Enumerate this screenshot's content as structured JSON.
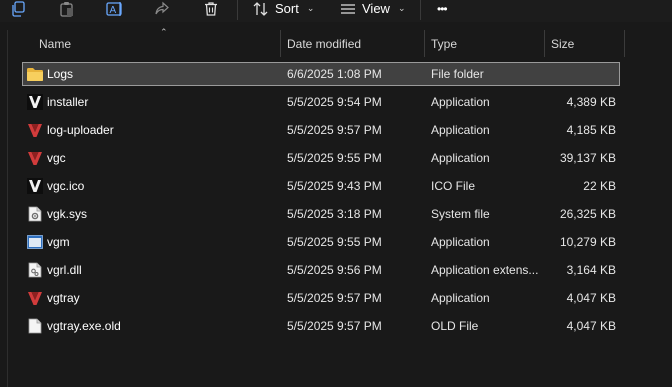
{
  "toolbar": {
    "copy_icon": "copy-icon",
    "paste_icon": "paste-icon",
    "rename_icon": "rename-icon",
    "share_icon": "share-icon",
    "delete_icon": "trash-icon",
    "sort_label": "Sort",
    "view_label": "View",
    "more_label": "•••"
  },
  "columns": {
    "name": "Name",
    "date": "Date modified",
    "type": "Type",
    "size": "Size"
  },
  "files": [
    {
      "name": "Logs",
      "date": "6/6/2025 1:08 PM",
      "type": "File folder",
      "size": "",
      "icon": "folder-icon",
      "selected": true
    },
    {
      "name": "installer",
      "date": "5/5/2025 9:54 PM",
      "type": "Application",
      "size": "4,389 KB",
      "icon": "vanguard-black-app-icon"
    },
    {
      "name": "log-uploader",
      "date": "5/5/2025 9:57 PM",
      "type": "Application",
      "size": "4,185 KB",
      "icon": "vanguard-red-app-icon"
    },
    {
      "name": "vgc",
      "date": "5/5/2025 9:55 PM",
      "type": "Application",
      "size": "39,137 KB",
      "icon": "vanguard-red-app-icon"
    },
    {
      "name": "vgc.ico",
      "date": "5/5/2025 9:43 PM",
      "type": "ICO File",
      "size": "22 KB",
      "icon": "vanguard-black-app-icon"
    },
    {
      "name": "vgk.sys",
      "date": "5/5/2025 3:18 PM",
      "type": "System file",
      "size": "26,325 KB",
      "icon": "system-file-icon"
    },
    {
      "name": "vgm",
      "date": "5/5/2025 9:55 PM",
      "type": "Application",
      "size": "10,279 KB",
      "icon": "window-app-icon"
    },
    {
      "name": "vgrl.dll",
      "date": "5/5/2025 9:56 PM",
      "type": "Application extens...",
      "size": "3,164 KB",
      "icon": "dll-file-icon"
    },
    {
      "name": "vgtray",
      "date": "5/5/2025 9:57 PM",
      "type": "Application",
      "size": "4,047 KB",
      "icon": "vanguard-red-app-icon"
    },
    {
      "name": "vgtray.exe.old",
      "date": "5/5/2025 9:57 PM",
      "type": "OLD File",
      "size": "4,047 KB",
      "icon": "blank-file-icon"
    }
  ],
  "colors": {
    "background": "#191919",
    "selection": "#414141",
    "folder": "#f5c54b",
    "vanguard_red": "#d13b3b"
  }
}
